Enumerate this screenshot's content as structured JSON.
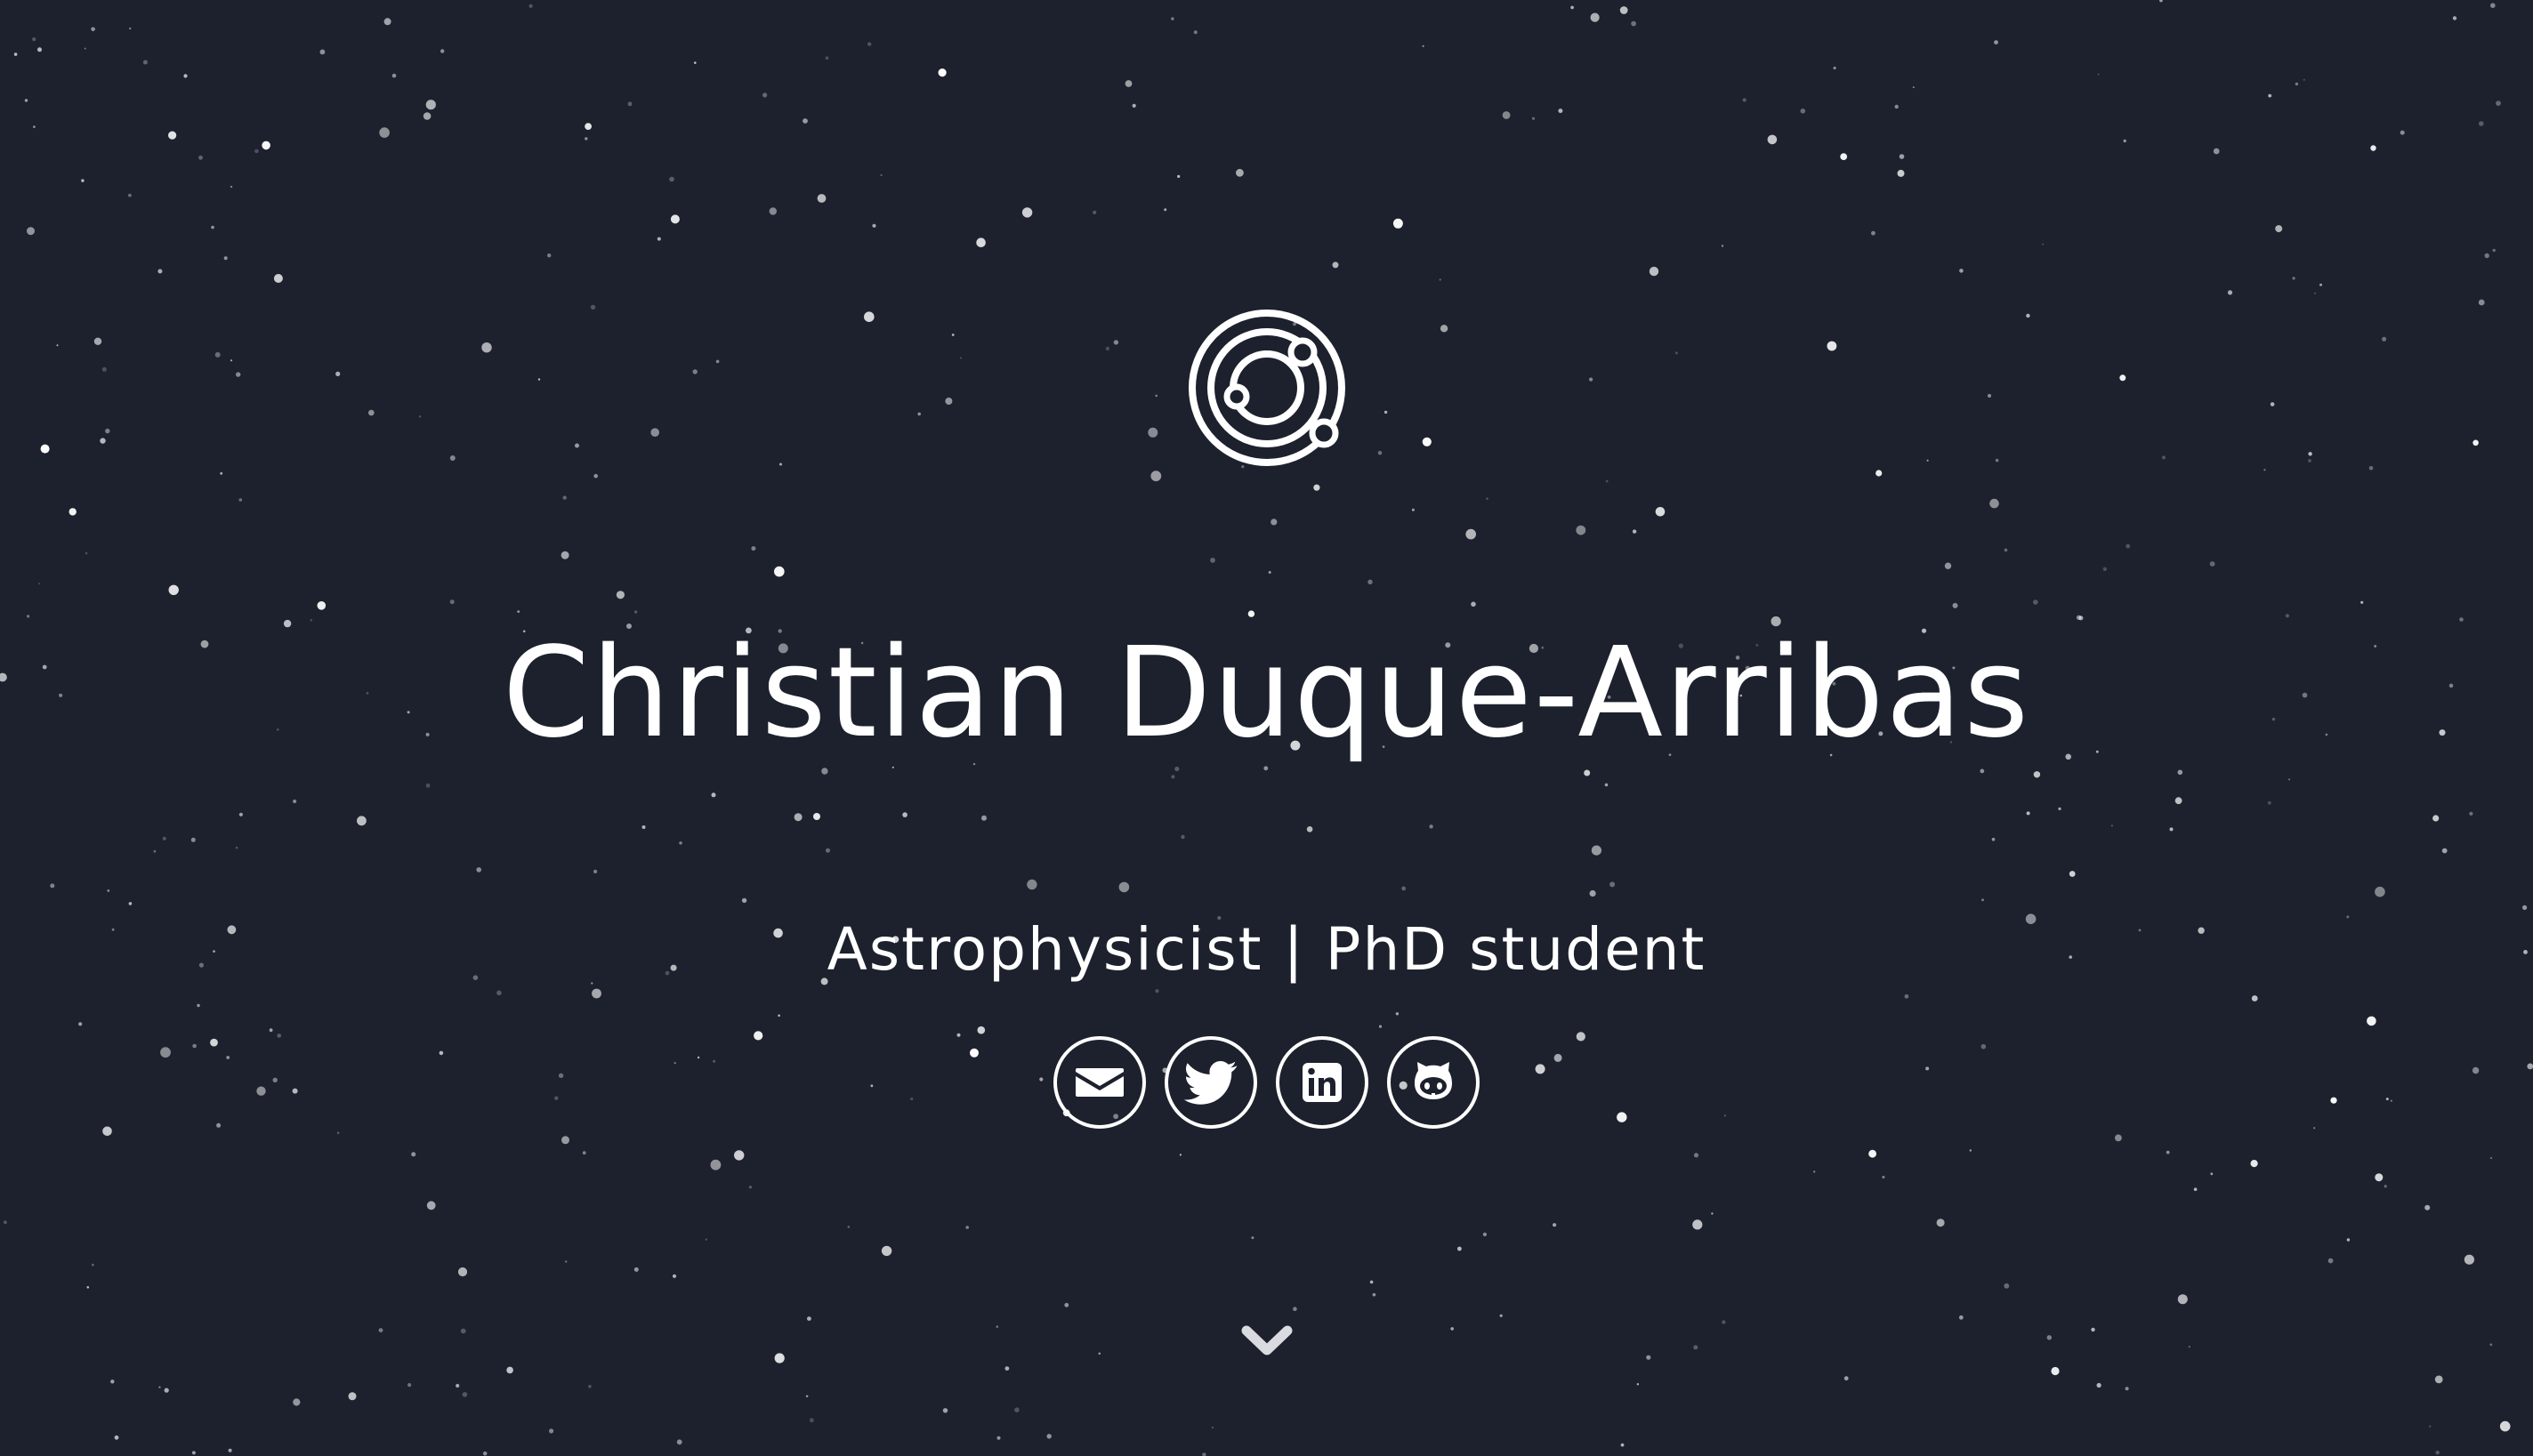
{
  "hero": {
    "name": "Christian Duque-Arribas",
    "tagline": "Astrophysicist | PhD student"
  },
  "social_links": [
    {
      "name": "email",
      "icon": "envelope-icon"
    },
    {
      "name": "twitter",
      "icon": "twitter-bird-icon"
    },
    {
      "name": "linkedin",
      "icon": "linkedin-icon"
    },
    {
      "name": "github",
      "icon": "github-octocat-icon"
    }
  ],
  "logo_icon": "orbit-icon",
  "scroll_icon": "chevron-down-icon",
  "colors": {
    "background": "#1c212d",
    "foreground": "#ffffff",
    "scroll_arrow": "#d9dbe0"
  }
}
